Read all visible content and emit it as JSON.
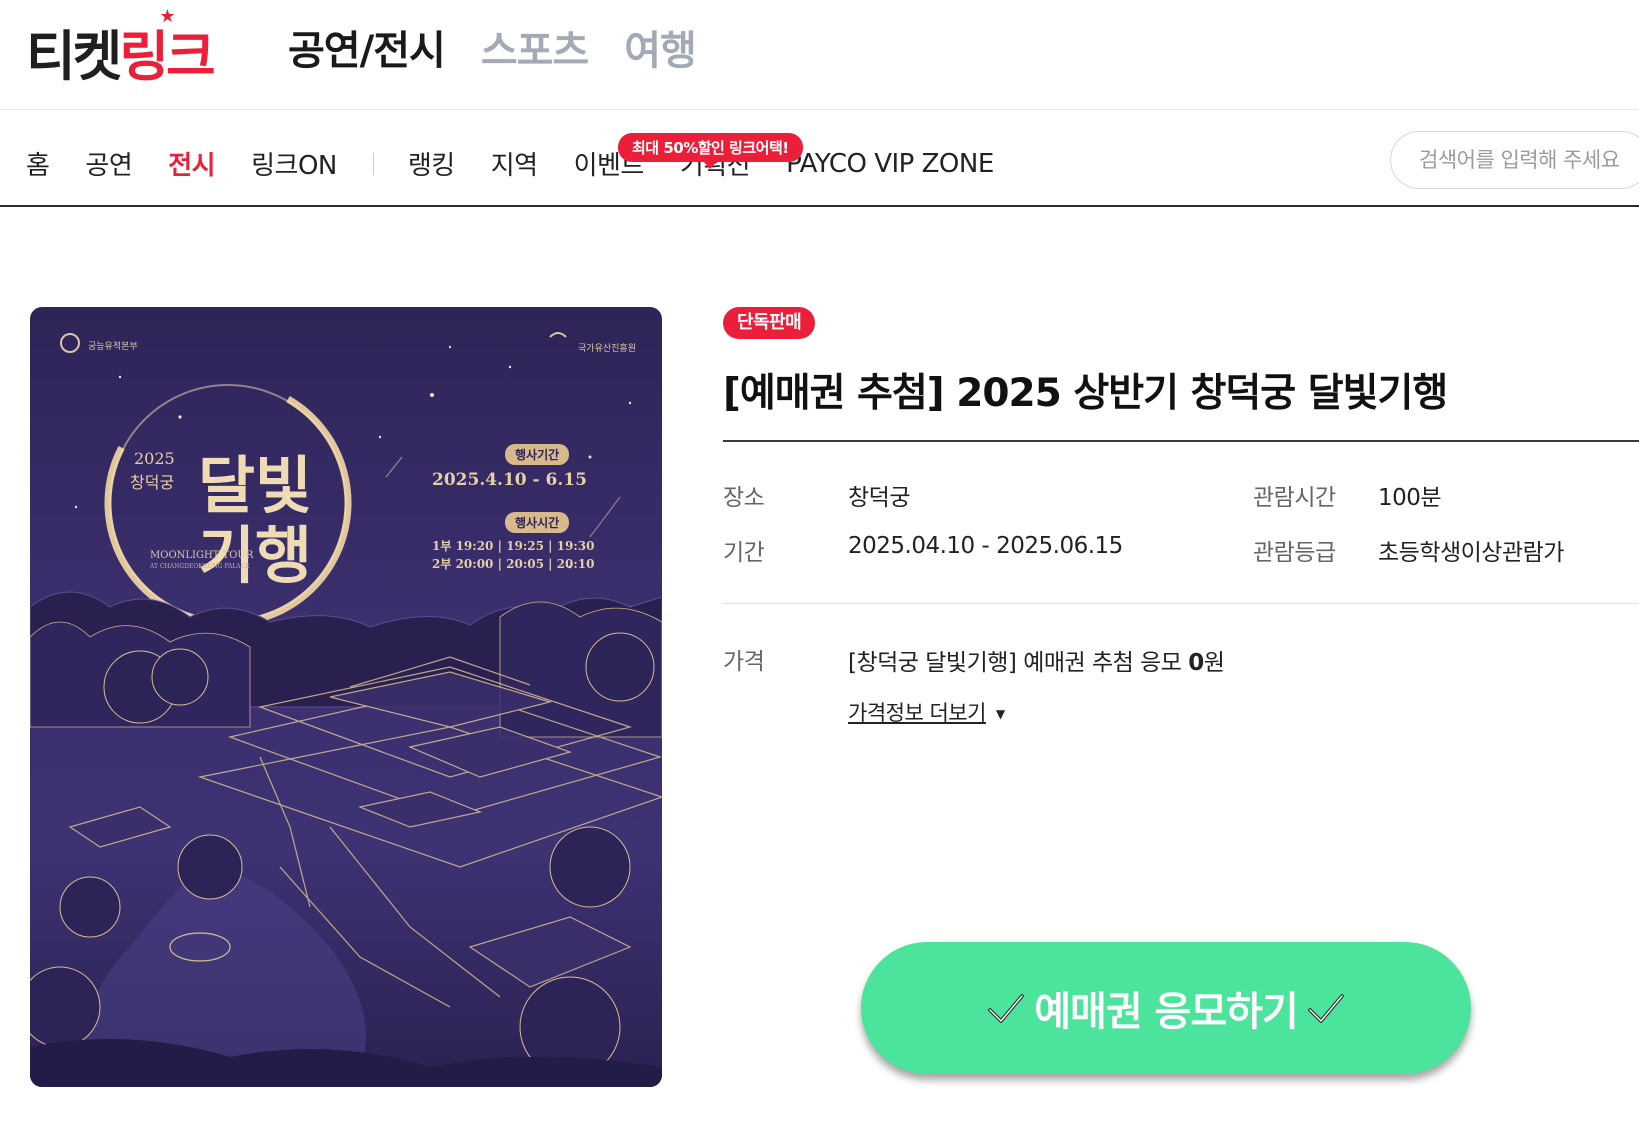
{
  "header": {
    "logo_left": "티켓",
    "logo_right": "링크",
    "categories": [
      {
        "label": "공연/전시",
        "active": true
      },
      {
        "label": "스포츠",
        "active": false
      },
      {
        "label": "여행",
        "active": false
      }
    ]
  },
  "subnav": {
    "items": [
      {
        "label": "홈",
        "active": false
      },
      {
        "label": "공연",
        "active": false
      },
      {
        "label": "전시",
        "active": true
      },
      {
        "label": "링크ON",
        "active": false
      },
      {
        "label": "랭킹",
        "active": false
      },
      {
        "label": "지역",
        "active": false
      },
      {
        "label": "이벤트",
        "active": false
      },
      {
        "label": "기획전",
        "active": false
      },
      {
        "label": "PAYCO VIP ZONE",
        "active": false
      }
    ],
    "promo_bubble": "최대 50%할인 링크어택!",
    "search_placeholder": "검색어를 입력해 주세요"
  },
  "poster": {
    "year": "2025",
    "palace": "창덕궁",
    "title_line1": "달빛",
    "title_line2": "기행",
    "english_title": "MOONLIGHT TOUR",
    "english_subtitle": "AT CHANGDEOKGUNG PALACE",
    "period_label": "행사기간",
    "period": "2025.4.10 - 6.15",
    "time_label": "행사시간",
    "time_row1": "1부 19:20 | 19:25 | 19:30",
    "time_row2": "2부 20:00 | 20:05 | 20:10",
    "org_left": "궁능유적본부",
    "org_right": "국가유산진흥원"
  },
  "product": {
    "badge": "단독판매",
    "title": "[예매권 추첨] 2025 상반기 창덕궁 달빛기행",
    "info": {
      "venue_label": "장소",
      "venue": "창덕궁",
      "runtime_label": "관람시간",
      "runtime": "100분",
      "period_label": "기간",
      "period": "2025.04.10 - 2025.06.15",
      "rating_label": "관람등급",
      "rating": "초등학생이상관람가"
    },
    "price_label": "가격",
    "price_desc": "[창덕궁 달빛기행] 예매권 추첨 응모 ",
    "price_amount": "0",
    "price_unit": "원",
    "more_price": "가격정보 더보기"
  },
  "cta": {
    "label": "예매권 응모하기",
    "icon": "checkmark-icon",
    "color": "#4ce39c"
  },
  "colors": {
    "brand_red": "#ec1f3a",
    "poster_bg": "#3b2f6e",
    "poster_gold": "#e6cfa5"
  }
}
